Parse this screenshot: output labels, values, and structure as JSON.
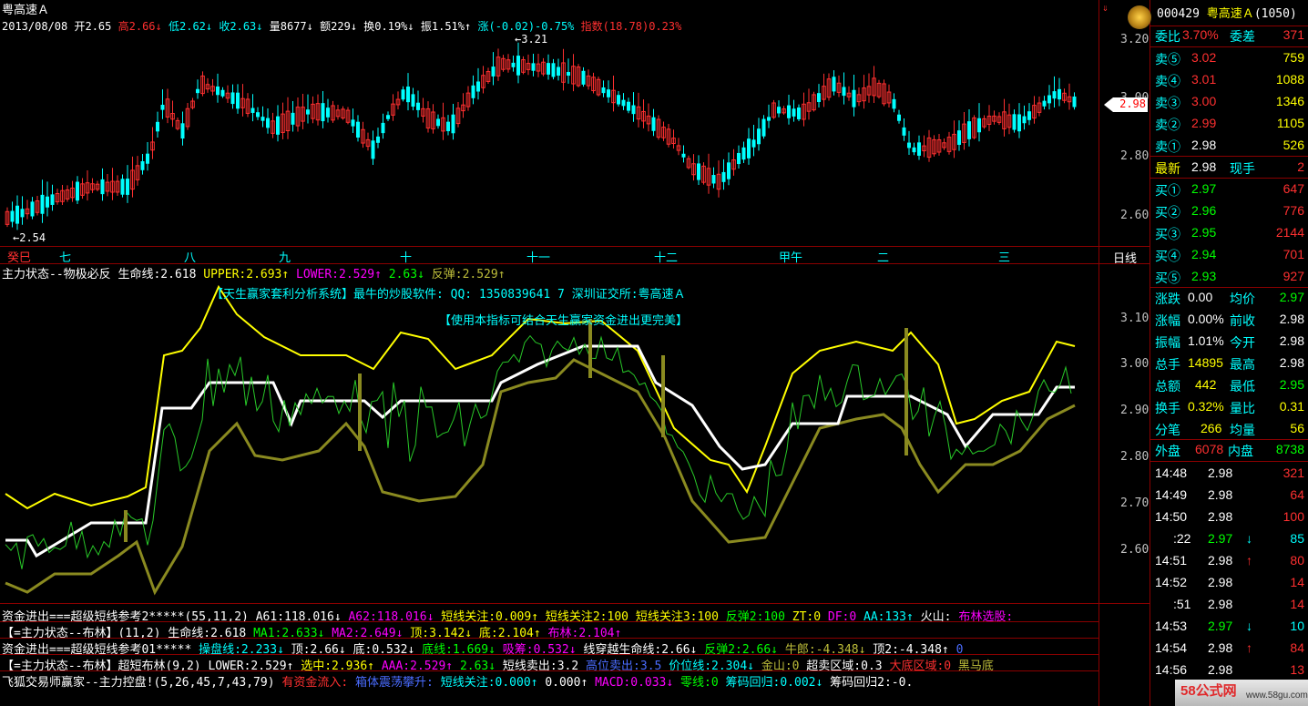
{
  "header": {
    "stock_title": "粤高速Ａ",
    "date": "2013/08/08",
    "open": "开2.65",
    "high": "高2.66",
    "low": "低2.62",
    "close": "收2.63",
    "volume": "量8677",
    "amount": "额229",
    "turnover": "换0.19%",
    "amplitude": "振1.51%",
    "change": "涨(-0.02)-0.75%",
    "index": "指数(18.78)0.23%",
    "high_mark": "3.21",
    "low_mark": "2.54",
    "current_price": "2.98",
    "period": "日线"
  },
  "price_axis": [
    "3.20",
    "3.00",
    "2.80",
    "2.60"
  ],
  "months": [
    "癸巳",
    "七",
    "八",
    "九",
    "十",
    "十一",
    "十二",
    "甲午",
    "二",
    "三"
  ],
  "indicator": {
    "header": [
      "主力状态--物极必反",
      "生命线:2.618",
      "UPPER:2.693",
      "LOWER:2.529",
      "2.63",
      "反弹:2.529"
    ],
    "ad_line1": "【天生赢家套利分析系统】最牛的炒股软件: QQ: 1350839641 7  深圳证交所:粤高速Ａ",
    "ad_line2": "【使用本指标可结合天生赢家资金进出更完美】",
    "axis": [
      "3.10",
      "3.00",
      "2.90",
      "2.80",
      "2.70",
      "2.60"
    ]
  },
  "bottom_lines": {
    "l1": [
      "资金进出===超级短线参考2*****(55,11,2)",
      "A61:118.016",
      "A62:118.016",
      "短线关注:0.009",
      "短线关注2:100",
      "短线关注3:100",
      "反弹2:100",
      "ZT:0",
      "DF:0",
      "AA:133",
      "火山:",
      "布林选股:"
    ],
    "l2": [
      "【=主力状态--布林】(11,2)",
      "生命线:2.618",
      "MA1:2.633",
      "MA2:2.649",
      "顶:3.142",
      "底:2.104",
      "布林:2.104"
    ],
    "l3": [
      "资金进出===超级短线参考01*****",
      "操盘线:2.233",
      "顶:2.66",
      "底:0.532",
      "底线:1.669",
      "吸筹:0.532",
      "线穿越生命线:2.66",
      "反弹2:2.66",
      "牛郎:-4.348",
      "顶2:-4.348",
      "0"
    ],
    "l4": [
      "【=主力状态--布林】超短布林(9,2)",
      "LOWER:2.529",
      "选中:2.936",
      "AAA:2.529",
      "2.63",
      "短线卖出:3.2",
      "高位卖出:3.5",
      "价位线:2.304",
      "金山:0",
      "超卖区域:0.3",
      "大底区域:0",
      "黑马底"
    ],
    "l5": [
      "飞狐交易师赢家--主力控盘!(5,26,45,7,43,79)",
      "有资金流入:",
      "箱体震荡攀升:",
      "短线关注:0.000",
      "0.000",
      "MACD:0.033",
      "零线:0",
      "筹码回归:0.002",
      "筹码回归2:-0."
    ]
  },
  "panel": {
    "code": "000429",
    "name": "粤高速Ａ",
    "code_suffix": "(1050)",
    "weibi_label": "委比",
    "weibi": "3.70%",
    "weicha_label": "委差",
    "weicha": "371",
    "sells": [
      {
        "l": "卖⑤",
        "p": "3.02",
        "v": "759"
      },
      {
        "l": "卖④",
        "p": "3.01",
        "v": "1088"
      },
      {
        "l": "卖③",
        "p": "3.00",
        "v": "1346"
      },
      {
        "l": "卖②",
        "p": "2.99",
        "v": "1105"
      },
      {
        "l": "卖①",
        "p": "2.98",
        "v": "526"
      }
    ],
    "latest_label": "最新",
    "latest": "2.98",
    "xianshou_label": "现手",
    "xianshou": "2",
    "buys": [
      {
        "l": "买①",
        "p": "2.97",
        "v": "647"
      },
      {
        "l": "买②",
        "p": "2.96",
        "v": "776"
      },
      {
        "l": "买③",
        "p": "2.95",
        "v": "2144"
      },
      {
        "l": "买④",
        "p": "2.94",
        "v": "701"
      },
      {
        "l": "买⑤",
        "p": "2.93",
        "v": "927"
      }
    ],
    "stats": [
      {
        "a": "涨跌",
        "b": "0.00",
        "c": "均价",
        "d": "2.97"
      },
      {
        "a": "涨幅",
        "b": "0.00%",
        "c": "前收",
        "d": "2.98"
      },
      {
        "a": "振幅",
        "b": "1.01%",
        "c": "今开",
        "d": "2.98"
      },
      {
        "a": "总手",
        "b": "14895",
        "c": "最高",
        "d": "2.98"
      },
      {
        "a": "总额",
        "b": "442",
        "c": "最低",
        "d": "2.95"
      },
      {
        "a": "换手",
        "b": "0.32%",
        "c": "量比",
        "d": "0.31"
      },
      {
        "a": "分笔",
        "b": "266",
        "c": "均量",
        "d": "56"
      }
    ],
    "waipan_label": "外盘",
    "waipan": "6078",
    "neipan_label": "内盘",
    "neipan": "8738",
    "ticks": [
      {
        "t": "14:48",
        "p": "2.98",
        "a": "",
        "v": "321"
      },
      {
        "t": "14:49",
        "p": "2.98",
        "a": "",
        "v": "64"
      },
      {
        "t": "14:50",
        "p": "2.98",
        "a": "",
        "v": "100"
      },
      {
        "t": ":22",
        "p": "2.97",
        "a": "↓",
        "v": "85"
      },
      {
        "t": "14:51",
        "p": "2.98",
        "a": "↑",
        "v": "80"
      },
      {
        "t": "14:52",
        "p": "2.98",
        "a": "",
        "v": "14"
      },
      {
        "t": ":51",
        "p": "2.98",
        "a": "",
        "v": "14"
      },
      {
        "t": "14:53",
        "p": "2.97",
        "a": "↓",
        "v": "10"
      },
      {
        "t": "14:54",
        "p": "2.98",
        "a": "↑",
        "v": "84"
      },
      {
        "t": "14:56",
        "p": "2.98",
        "a": "",
        "v": "13"
      }
    ],
    "watermark": "58公式网",
    "watermark_url": "www.58gu.com"
  }
}
